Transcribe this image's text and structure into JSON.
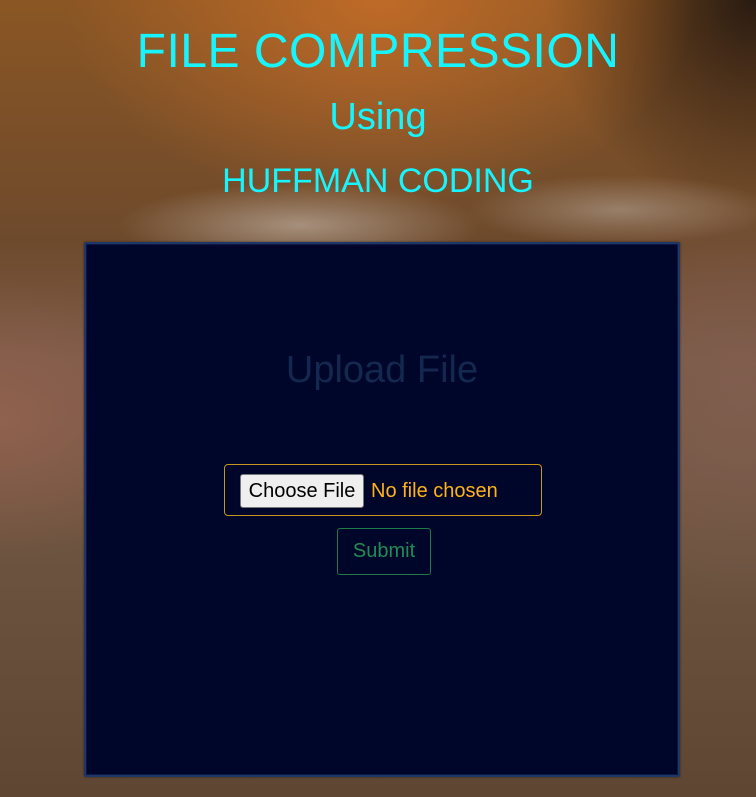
{
  "header": {
    "title": "FILE COMPRESSION",
    "subtitle": "Using",
    "method": "HUFFMAN CODING"
  },
  "upload_panel": {
    "heading": "Upload File",
    "file_input": {
      "button_label": "Choose File",
      "status_text": "No file chosen"
    },
    "submit_label": "Submit"
  },
  "colors": {
    "header_text": "#16f5ff",
    "panel_background": "#00052a",
    "panel_border": "#1e3766",
    "upload_heading": "#13284e",
    "file_box_border": "#c8961c",
    "file_status_text": "#ffb21b",
    "submit_text": "#1f8d55",
    "submit_border": "#1f7a4a"
  }
}
